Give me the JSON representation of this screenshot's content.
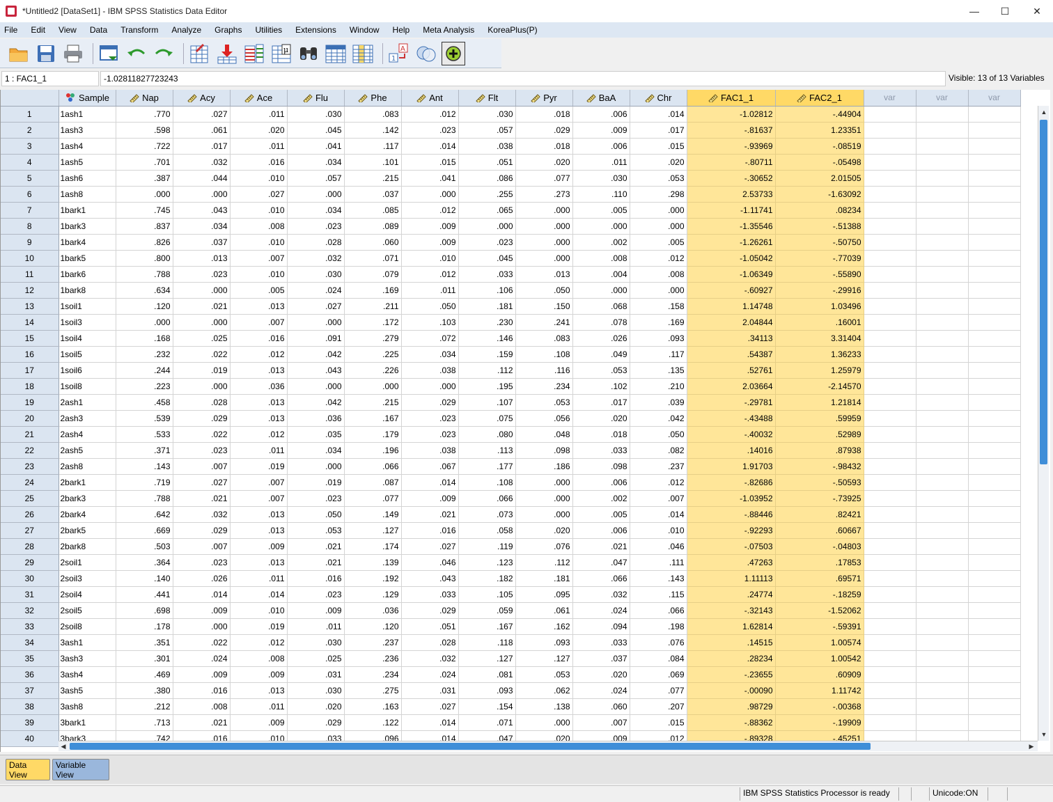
{
  "window": {
    "title": "*Untitled2 [DataSet1] - IBM SPSS Statistics Data Editor",
    "minimize": "—",
    "maximize": "☐",
    "close": "✕"
  },
  "menu": [
    "File",
    "Edit",
    "View",
    "Data",
    "Transform",
    "Analyze",
    "Graphs",
    "Utilities",
    "Extensions",
    "Window",
    "Help",
    "Meta Analysis",
    "KoreaPlus(P)"
  ],
  "toolbar": {
    "icons": [
      "open-icon",
      "save-icon",
      "print-icon",
      "dialog-recall-icon",
      "undo-icon",
      "redo-icon",
      "goto-case-icon",
      "goto-variable-icon",
      "variables-icon",
      "descriptives-icon",
      "find-icon",
      "insert-cases-icon",
      "insert-variable-icon",
      "value-labels-icon",
      "use-sets-icon",
      "add-icon"
    ]
  },
  "cell_editor": {
    "reference": "1 : FAC1_1",
    "value": "-1.02811827723243",
    "visible_text": "Visible: 13 of 13 Variables"
  },
  "grid": {
    "columns": [
      "Sample",
      "Nap",
      "Acy",
      "Ace",
      "Flu",
      "Phe",
      "Ant",
      "Flt",
      "Pyr",
      "BaA",
      "Chr",
      "FAC1_1",
      "FAC2_1",
      "var",
      "var",
      "var"
    ],
    "column_kinds": [
      "nominal",
      "scale",
      "scale",
      "scale",
      "scale",
      "scale",
      "scale",
      "scale",
      "scale",
      "scale",
      "scale",
      "scale",
      "scale",
      "empty",
      "empty",
      "empty"
    ],
    "highlight_color": "#ffe699",
    "rows": [
      [
        "1",
        "1ash1",
        ".770",
        ".027",
        ".011",
        ".030",
        ".083",
        ".012",
        ".030",
        ".018",
        ".006",
        ".014",
        "-1.02812",
        "-.44904"
      ],
      [
        "2",
        "1ash3",
        ".598",
        ".061",
        ".020",
        ".045",
        ".142",
        ".023",
        ".057",
        ".029",
        ".009",
        ".017",
        "-.81637",
        "1.23351"
      ],
      [
        "3",
        "1ash4",
        ".722",
        ".017",
        ".011",
        ".041",
        ".117",
        ".014",
        ".038",
        ".018",
        ".006",
        ".015",
        "-.93969",
        "-.08519"
      ],
      [
        "4",
        "1ash5",
        ".701",
        ".032",
        ".016",
        ".034",
        ".101",
        ".015",
        ".051",
        ".020",
        ".011",
        ".020",
        "-.80711",
        "-.05498"
      ],
      [
        "5",
        "1ash6",
        ".387",
        ".044",
        ".010",
        ".057",
        ".215",
        ".041",
        ".086",
        ".077",
        ".030",
        ".053",
        "-.30652",
        "2.01505"
      ],
      [
        "6",
        "1ash8",
        ".000",
        ".000",
        ".027",
        ".000",
        ".037",
        ".000",
        ".255",
        ".273",
        ".110",
        ".298",
        "2.53733",
        "-1.63092"
      ],
      [
        "7",
        "1bark1",
        ".745",
        ".043",
        ".010",
        ".034",
        ".085",
        ".012",
        ".065",
        ".000",
        ".005",
        ".000",
        "-1.11741",
        ".08234"
      ],
      [
        "8",
        "1bark3",
        ".837",
        ".034",
        ".008",
        ".023",
        ".089",
        ".009",
        ".000",
        ".000",
        ".000",
        ".000",
        "-1.35546",
        "-.51388"
      ],
      [
        "9",
        "1bark4",
        ".826",
        ".037",
        ".010",
        ".028",
        ".060",
        ".009",
        ".023",
        ".000",
        ".002",
        ".005",
        "-1.26261",
        "-.50750"
      ],
      [
        "10",
        "1bark5",
        ".800",
        ".013",
        ".007",
        ".032",
        ".071",
        ".010",
        ".045",
        ".000",
        ".008",
        ".012",
        "-1.05042",
        "-.77039"
      ],
      [
        "11",
        "1bark6",
        ".788",
        ".023",
        ".010",
        ".030",
        ".079",
        ".012",
        ".033",
        ".013",
        ".004",
        ".008",
        "-1.06349",
        "-.55890"
      ],
      [
        "12",
        "1bark8",
        ".634",
        ".000",
        ".005",
        ".024",
        ".169",
        ".011",
        ".106",
        ".050",
        ".000",
        ".000",
        "-.60927",
        "-.29916"
      ],
      [
        "13",
        "1soil1",
        ".120",
        ".021",
        ".013",
        ".027",
        ".211",
        ".050",
        ".181",
        ".150",
        ".068",
        ".158",
        "1.14748",
        "1.03496"
      ],
      [
        "14",
        "1soil3",
        ".000",
        ".000",
        ".007",
        ".000",
        ".172",
        ".103",
        ".230",
        ".241",
        ".078",
        ".169",
        "2.04844",
        ".16001"
      ],
      [
        "15",
        "1soil4",
        ".168",
        ".025",
        ".016",
        ".091",
        ".279",
        ".072",
        ".146",
        ".083",
        ".026",
        ".093",
        ".34113",
        "3.31404"
      ],
      [
        "16",
        "1soil5",
        ".232",
        ".022",
        ".012",
        ".042",
        ".225",
        ".034",
        ".159",
        ".108",
        ".049",
        ".117",
        ".54387",
        "1.36233"
      ],
      [
        "17",
        "1soil6",
        ".244",
        ".019",
        ".013",
        ".043",
        ".226",
        ".038",
        ".112",
        ".116",
        ".053",
        ".135",
        ".52761",
        "1.25979"
      ],
      [
        "18",
        "1soil8",
        ".223",
        ".000",
        ".036",
        ".000",
        ".000",
        ".000",
        ".195",
        ".234",
        ".102",
        ".210",
        "2.03664",
        "-2.14570"
      ],
      [
        "19",
        "2ash1",
        ".458",
        ".028",
        ".013",
        ".042",
        ".215",
        ".029",
        ".107",
        ".053",
        ".017",
        ".039",
        "-.29781",
        "1.21814"
      ],
      [
        "20",
        "2ash3",
        ".539",
        ".029",
        ".013",
        ".036",
        ".167",
        ".023",
        ".075",
        ".056",
        ".020",
        ".042",
        "-.43488",
        ".59959"
      ],
      [
        "21",
        "2ash4",
        ".533",
        ".022",
        ".012",
        ".035",
        ".179",
        ".023",
        ".080",
        ".048",
        ".018",
        ".050",
        "-.40032",
        ".52989"
      ],
      [
        "22",
        "2ash5",
        ".371",
        ".023",
        ".011",
        ".034",
        ".196",
        ".038",
        ".113",
        ".098",
        ".033",
        ".082",
        ".14016",
        ".87938"
      ],
      [
        "23",
        "2ash8",
        ".143",
        ".007",
        ".019",
        ".000",
        ".066",
        ".067",
        ".177",
        ".186",
        ".098",
        ".237",
        "1.91703",
        "-.98432"
      ],
      [
        "24",
        "2bark1",
        ".719",
        ".027",
        ".007",
        ".019",
        ".087",
        ".014",
        ".108",
        ".000",
        ".006",
        ".012",
        "-.82686",
        "-.50593"
      ],
      [
        "25",
        "2bark3",
        ".788",
        ".021",
        ".007",
        ".023",
        ".077",
        ".009",
        ".066",
        ".000",
        ".002",
        ".007",
        "-1.03952",
        "-.73925"
      ],
      [
        "26",
        "2bark4",
        ".642",
        ".032",
        ".013",
        ".050",
        ".149",
        ".021",
        ".073",
        ".000",
        ".005",
        ".014",
        "-.88446",
        ".82421"
      ],
      [
        "27",
        "2bark5",
        ".669",
        ".029",
        ".013",
        ".053",
        ".127",
        ".016",
        ".058",
        ".020",
        ".006",
        ".010",
        "-.92293",
        ".60667"
      ],
      [
        "28",
        "2bark8",
        ".503",
        ".007",
        ".009",
        ".021",
        ".174",
        ".027",
        ".119",
        ".076",
        ".021",
        ".046",
        "-.07503",
        "-.04803"
      ],
      [
        "29",
        "2soil1",
        ".364",
        ".023",
        ".013",
        ".021",
        ".139",
        ".046",
        ".123",
        ".112",
        ".047",
        ".111",
        ".47263",
        ".17853"
      ],
      [
        "30",
        "2soil3",
        ".140",
        ".026",
        ".011",
        ".016",
        ".192",
        ".043",
        ".182",
        ".181",
        ".066",
        ".143",
        "1.11113",
        ".69571"
      ],
      [
        "31",
        "2soil4",
        ".441",
        ".014",
        ".014",
        ".023",
        ".129",
        ".033",
        ".105",
        ".095",
        ".032",
        ".115",
        ".24774",
        "-.18259"
      ],
      [
        "32",
        "2soil5",
        ".698",
        ".009",
        ".010",
        ".009",
        ".036",
        ".029",
        ".059",
        ".061",
        ".024",
        ".066",
        "-.32143",
        "-1.52062"
      ],
      [
        "33",
        "2soil8",
        ".178",
        ".000",
        ".019",
        ".011",
        ".120",
        ".051",
        ".167",
        ".162",
        ".094",
        ".198",
        "1.62814",
        "-.59391"
      ],
      [
        "34",
        "3ash1",
        ".351",
        ".022",
        ".012",
        ".030",
        ".237",
        ".028",
        ".118",
        ".093",
        ".033",
        ".076",
        ".14515",
        "1.00574"
      ],
      [
        "35",
        "3ash3",
        ".301",
        ".024",
        ".008",
        ".025",
        ".236",
        ".032",
        ".127",
        ".127",
        ".037",
        ".084",
        ".28234",
        "1.00542"
      ],
      [
        "36",
        "3ash4",
        ".469",
        ".009",
        ".009",
        ".031",
        ".234",
        ".024",
        ".081",
        ".053",
        ".020",
        ".069",
        "-.23655",
        ".60909"
      ],
      [
        "37",
        "3ash5",
        ".380",
        ".016",
        ".013",
        ".030",
        ".275",
        ".031",
        ".093",
        ".062",
        ".024",
        ".077",
        "-.00090",
        "1.11742"
      ],
      [
        "38",
        "3ash8",
        ".212",
        ".008",
        ".011",
        ".020",
        ".163",
        ".027",
        ".154",
        ".138",
        ".060",
        ".207",
        ".98729",
        "-.00368"
      ],
      [
        "39",
        "3bark1",
        ".713",
        ".021",
        ".009",
        ".029",
        ".122",
        ".014",
        ".071",
        ".000",
        ".007",
        ".015",
        "-.88362",
        "-.19909"
      ],
      [
        "40",
        "3bark3",
        ".742",
        ".016",
        ".010",
        ".033",
        ".096",
        ".014",
        ".047",
        ".020",
        ".009",
        ".012",
        "-.89328",
        "-.45251"
      ]
    ]
  },
  "tabs": {
    "data_view": "Data View",
    "variable_view": "Variable View"
  },
  "status": {
    "processor": "IBM SPSS Statistics Processor is ready",
    "unicode": "Unicode:ON"
  }
}
